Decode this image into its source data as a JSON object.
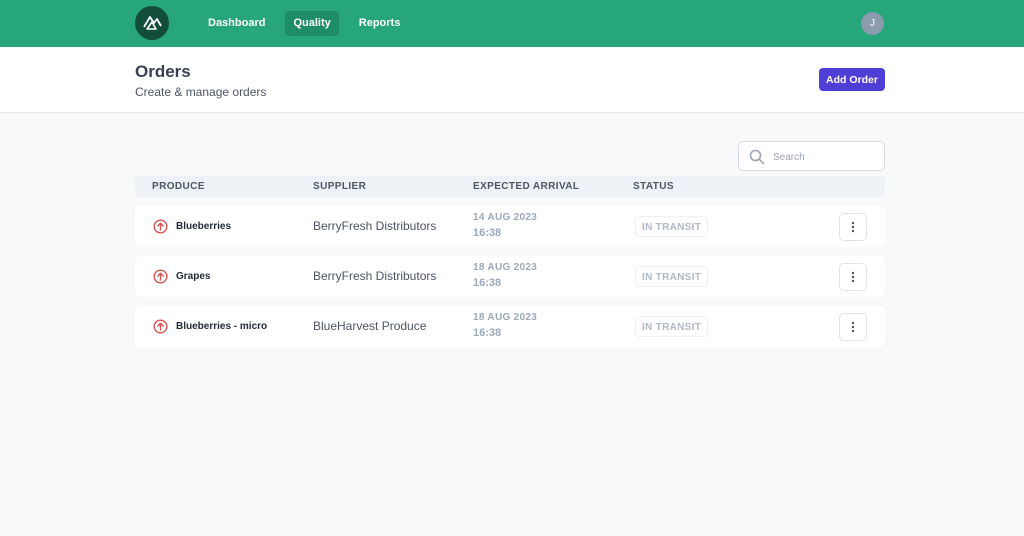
{
  "nav": {
    "items": [
      {
        "label": "Dashboard",
        "active": false
      },
      {
        "label": "Quality",
        "active": true
      },
      {
        "label": "Reports",
        "active": false
      }
    ],
    "avatar_initial": "J",
    "brand_color": "#27a57b"
  },
  "header": {
    "title": "Orders",
    "subtitle": "Create & manage orders",
    "add_button_label": "Add Order",
    "add_button_color": "#4f3fd6"
  },
  "search": {
    "placeholder": "Search",
    "icon": "search-icon"
  },
  "table": {
    "columns": [
      "PRODUCE",
      "SUPPLIER",
      "EXPECTED ARRIVAL",
      "STATUS"
    ],
    "rows": [
      {
        "produce": "Blueberries",
        "supplier": "BerryFresh Distributors",
        "date": "14 AUG 2023",
        "time": "16:38",
        "status": "IN TRANSIT",
        "icon": "arrow-up-circle-icon"
      },
      {
        "produce": "Grapes",
        "supplier": "BerryFresh Distributors",
        "date": "18 AUG 2023",
        "time": "16:38",
        "status": "IN TRANSIT",
        "icon": "arrow-up-circle-icon"
      },
      {
        "produce": "Blueberries - micro",
        "supplier": "BlueHarvest Produce",
        "date": "18 AUG 2023",
        "time": "16:38",
        "status": "IN TRANSIT",
        "icon": "arrow-up-circle-icon"
      }
    ],
    "row_icon_color": "#d9534f"
  }
}
